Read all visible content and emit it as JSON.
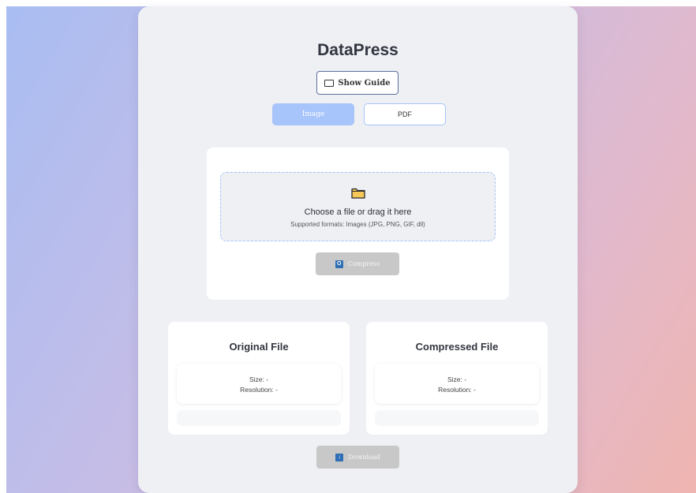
{
  "app": {
    "title": "DataPress"
  },
  "guide": {
    "label": "Show Guide",
    "icon": "book-icon"
  },
  "tabs": [
    {
      "label": "Image",
      "active": true
    },
    {
      "label": "PDF",
      "active": false
    }
  ],
  "upload": {
    "icon": "folder-icon",
    "title": "Choose a file or drag it here",
    "subtitle": "Supported formats: Images (JPG, PNG, GIF, dll)",
    "compress_label": "Compress",
    "compress_icon_glyph": "O"
  },
  "original": {
    "title": "Original File",
    "size_text": "Size: -",
    "resolution_text": "Resolution: -"
  },
  "compressed": {
    "title": "Compressed File",
    "size_text": "Size: -",
    "resolution_text": "Resolution: -"
  },
  "download": {
    "label": "Download",
    "icon_glyph": "↓"
  },
  "colors": {
    "accent": "#a7c4fb",
    "disabled_button": "#c8c8c8",
    "card": "#eef0f4",
    "title_text": "#333640"
  }
}
